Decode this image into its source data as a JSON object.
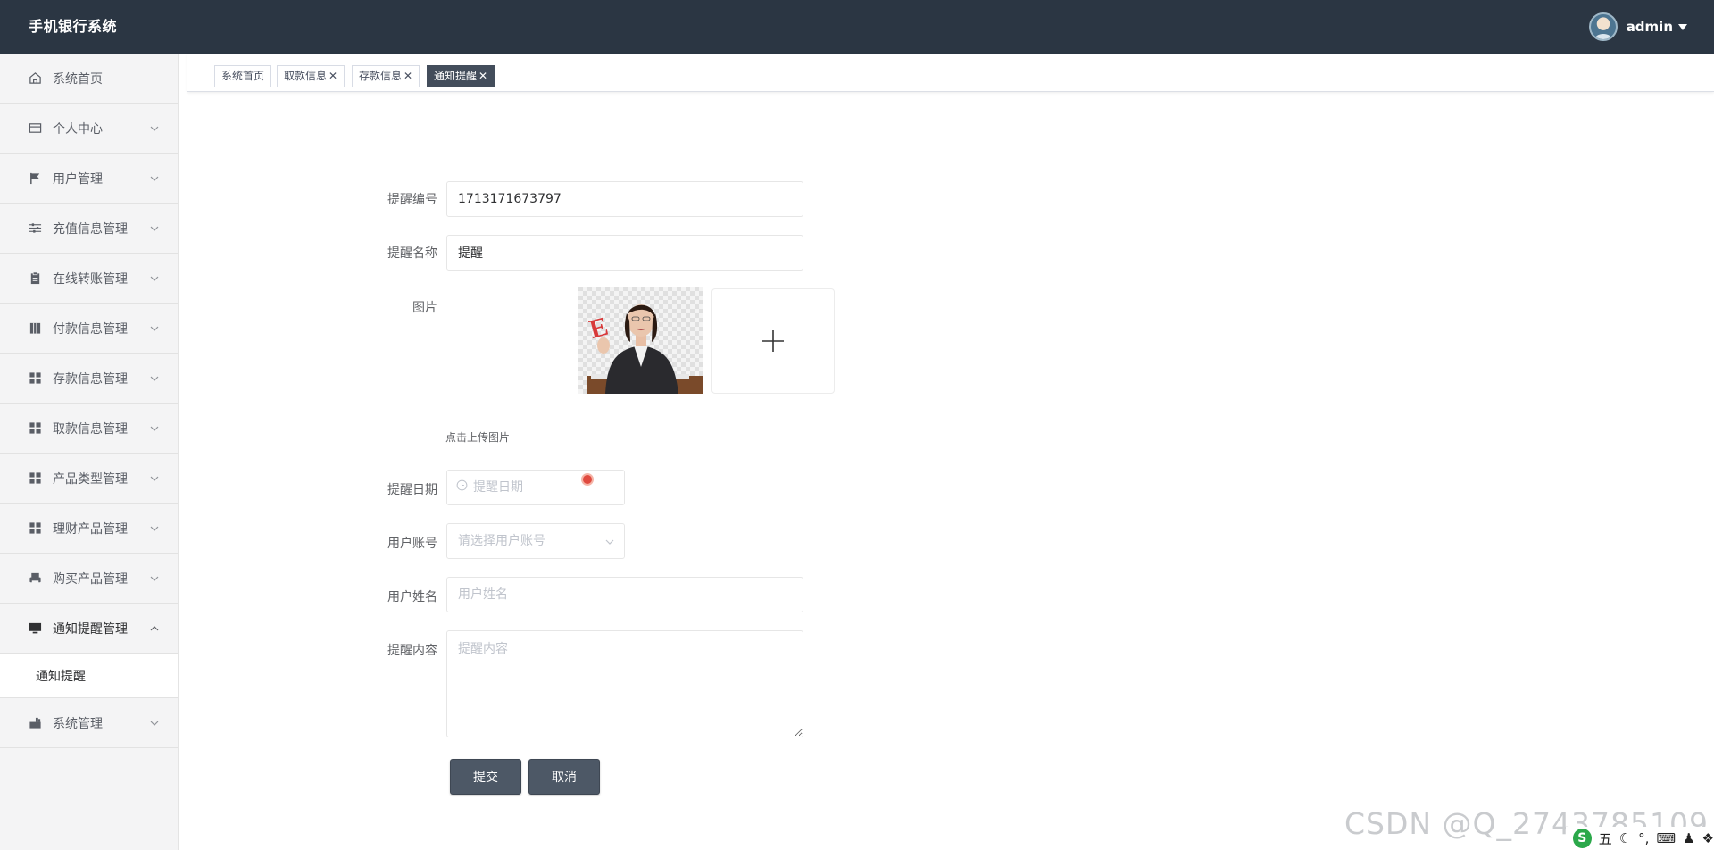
{
  "header": {
    "app_title": "手机银行系统",
    "user_name": "admin"
  },
  "sidebar": {
    "items": [
      {
        "label": "系统首页",
        "icon": "home-icon"
      },
      {
        "label": "个人中心",
        "icon": "card-icon"
      },
      {
        "label": "用户管理",
        "icon": "flag-icon"
      },
      {
        "label": "充值信息管理",
        "icon": "sliders-icon"
      },
      {
        "label": "在线转账管理",
        "icon": "clipboard-icon"
      },
      {
        "label": "付款信息管理",
        "icon": "book-icon"
      },
      {
        "label": "存款信息管理",
        "icon": "grid-icon"
      },
      {
        "label": "取款信息管理",
        "icon": "grid-icon"
      },
      {
        "label": "产品类型管理",
        "icon": "grid-icon"
      },
      {
        "label": "理财产品管理",
        "icon": "grid-icon"
      },
      {
        "label": "购买产品管理",
        "icon": "printer-icon"
      },
      {
        "label": "通知提醒管理",
        "icon": "monitor-icon"
      },
      {
        "label": "系统管理",
        "icon": "chart-icon"
      }
    ],
    "open_submenu_item": "通知提醒"
  },
  "tags": [
    {
      "label": "系统首页",
      "closable": false
    },
    {
      "label": "取款信息",
      "closable": true
    },
    {
      "label": "存款信息",
      "closable": true
    },
    {
      "label": "通知提醒",
      "closable": true,
      "active": true
    }
  ],
  "form": {
    "reminder_no_label": "提醒编号",
    "reminder_no_value": "1713171673797",
    "reminder_name_label": "提醒名称",
    "reminder_name_value": "提醒",
    "image_label": "图片",
    "upload_tip": "点击上传图片",
    "date_label": "提醒日期",
    "date_placeholder": "提醒日期",
    "account_label": "用户账号",
    "account_placeholder": "请选择用户账号",
    "username_label": "用户姓名",
    "username_placeholder": "用户姓名",
    "content_label": "提醒内容",
    "content_placeholder": "提醒内容",
    "submit_label": "提交",
    "cancel_label": "取消"
  },
  "watermark": "CSDN @Q_2743785109",
  "tray": {
    "ime_label": "五"
  }
}
